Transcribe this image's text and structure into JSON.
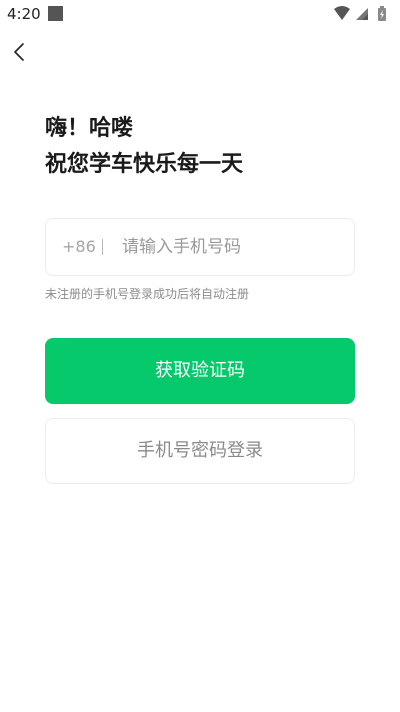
{
  "status_bar": {
    "time": "4:20",
    "icons": [
      "notification-square-icon",
      "wifi-icon",
      "signal-icon",
      "battery-charging-icon"
    ]
  },
  "nav": {
    "back_icon": "chevron-left-icon"
  },
  "greeting": {
    "line1": "嗨！哈喽",
    "line2": "祝您学车快乐每一天"
  },
  "phone": {
    "country_code": "+86",
    "placeholder": "请输入手机号码",
    "value": ""
  },
  "hint": "未注册的手机号登录成功后将自动注册",
  "buttons": {
    "get_code": "获取验证码",
    "password_login": "手机号密码登录"
  },
  "colors": {
    "primary": "#05c96b",
    "text": "#1a1a1a",
    "muted": "#8c8c8c"
  }
}
